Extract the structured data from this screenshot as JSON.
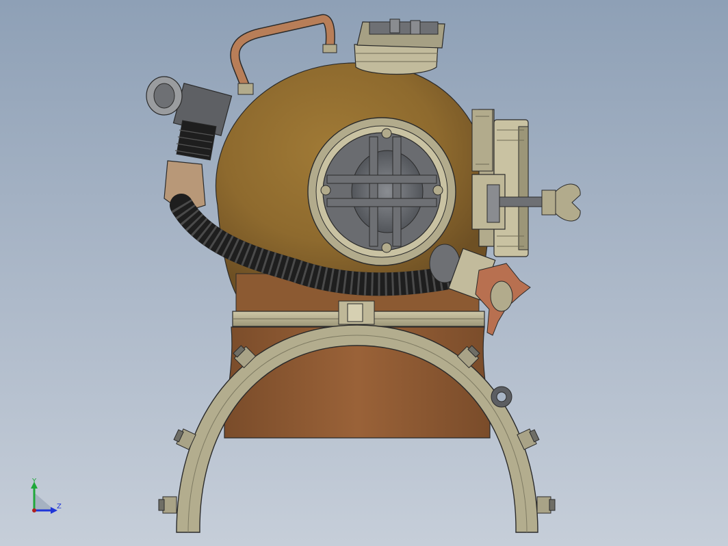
{
  "viewport": {
    "background_top": "#8ea0b6",
    "background_bottom": "#c6ced9"
  },
  "model": {
    "part": "diving-helmet-assembly",
    "colors": {
      "copper_dome": "#8e6a2e",
      "copper_collar": "#8c5a32",
      "brass_parts": "#b2ab8c",
      "dark_metal": "#5e6064",
      "hose_rubber": "#1e1e1e",
      "tan_tube": "#b89878",
      "edge_lines": "#2a2a2a"
    }
  },
  "triad": {
    "y_label": "Y",
    "z_label": "Z",
    "y_color": "#1fa83a",
    "z_color": "#2036d8"
  }
}
